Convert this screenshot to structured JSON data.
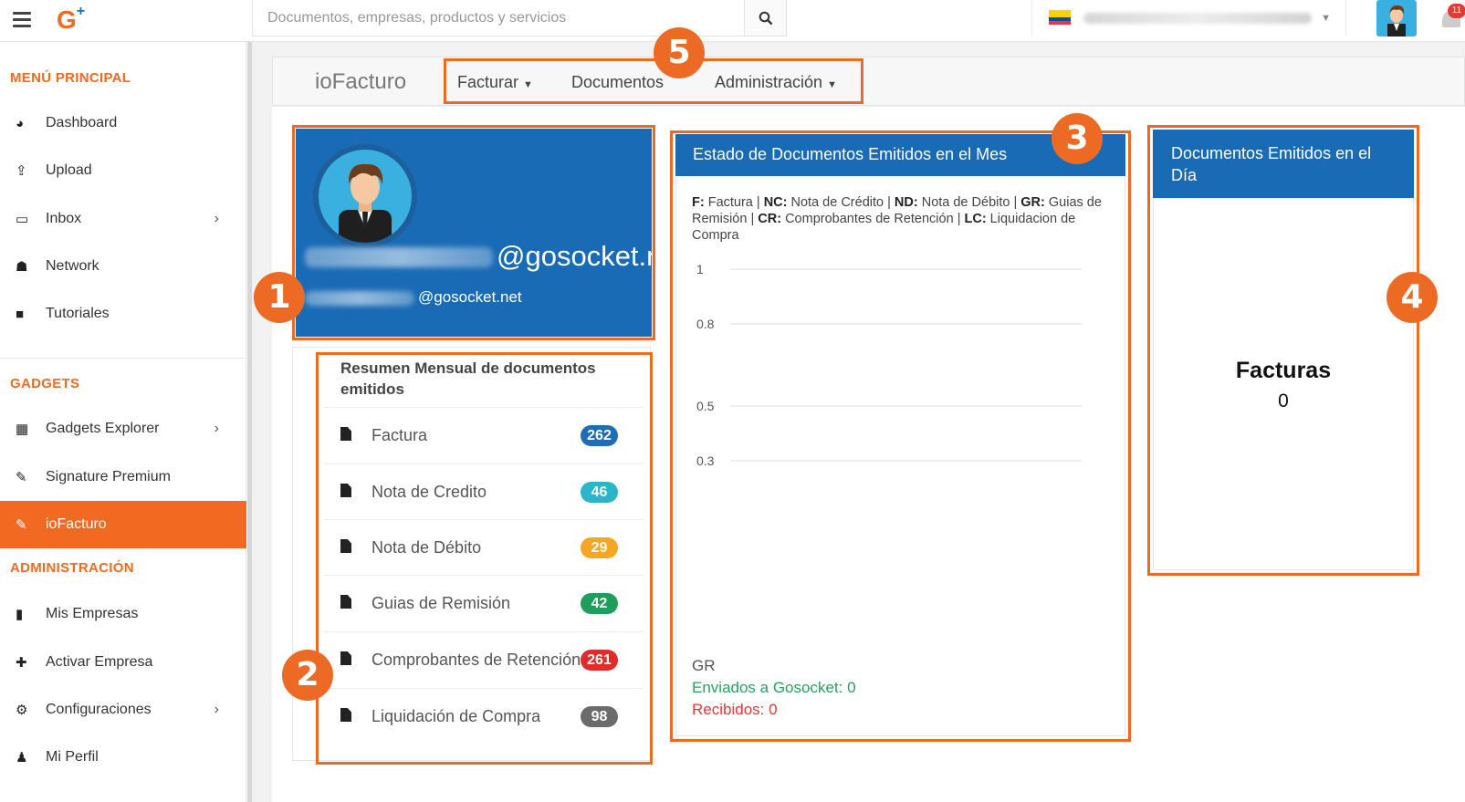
{
  "topbar": {
    "search_placeholder": "Documentos, empresas, productos y servicios",
    "notification_count": "11"
  },
  "sidebar": {
    "sections": [
      {
        "title": "MENÚ PRINCIPAL"
      },
      {
        "title": "GADGETS"
      },
      {
        "title": "ADMINISTRACIÓN"
      }
    ],
    "main_items": [
      {
        "label": "Dashboard",
        "icon": "dashboard-icon"
      },
      {
        "label": "Upload",
        "icon": "upload-icon"
      },
      {
        "label": "Inbox",
        "icon": "inbox-icon"
      },
      {
        "label": "Network",
        "icon": "network-icon"
      },
      {
        "label": "Tutoriales",
        "icon": "video-icon"
      }
    ],
    "gadget_items": [
      {
        "label": "Gadgets Explorer",
        "icon": "grid-icon"
      },
      {
        "label": "Signature Premium",
        "icon": "plug-icon"
      },
      {
        "label": "ioFacturo",
        "icon": "plug-icon"
      }
    ],
    "admin_items": [
      {
        "label": "Mis Empresas",
        "icon": "building-icon"
      },
      {
        "label": "Activar Empresa",
        "icon": "plus-icon"
      },
      {
        "label": "Configuraciones",
        "icon": "cogs-icon"
      },
      {
        "label": "Mi Perfil",
        "icon": "user-icon"
      }
    ]
  },
  "navbar": {
    "brand": "ioFacturo",
    "links": [
      "Facturar",
      "Documentos",
      "Administración"
    ]
  },
  "profile": {
    "email_domain_big": "@gosocket.r",
    "email_domain_small": "@gosocket.net"
  },
  "summary": {
    "title": "Resumen Mensual de documentos emitidos",
    "rows": [
      {
        "label": "Factura",
        "count": "262",
        "color": "#1f6db5"
      },
      {
        "label": "Nota de Credito",
        "count": "46",
        "color": "#2bb5c8"
      },
      {
        "label": "Nota de Débito",
        "count": "29",
        "color": "#f5a623"
      },
      {
        "label": "Guias de Remisión",
        "count": "42",
        "color": "#1e9e5a"
      },
      {
        "label": "Comprobantes de Retención",
        "count": "261",
        "color": "#e02b2b"
      },
      {
        "label": "Liquidación de Compra",
        "count": "98",
        "color": "#6b6b6b"
      }
    ]
  },
  "state": {
    "title": "Estado de Documentos Emitidos en el Mes",
    "legend": [
      {
        "code": "F:",
        "text": " Factura | "
      },
      {
        "code": "NC:",
        "text": " Nota de Crédito | "
      },
      {
        "code": "ND:",
        "text": " Nota de Débito | "
      },
      {
        "code": "GR:",
        "text": " Guias de Remisión | "
      },
      {
        "code": "CR:",
        "text": " Comprobantes de Retención | "
      },
      {
        "code": "LC:",
        "text": " Liquidacion de Compra"
      }
    ],
    "footer_label": "GR",
    "sent": "Enviados a Gosocket: 0",
    "received": "Recibidos: 0"
  },
  "chart_data": {
    "type": "bar",
    "categories": [],
    "series": [],
    "ytick_labels": [
      "1",
      "0.8",
      "0.5",
      "0.3"
    ],
    "ylim": [
      0,
      1
    ],
    "grid": true
  },
  "daily": {
    "title": "Documentos Emitidos en el Día",
    "label": "Facturas",
    "value": "0"
  },
  "markers": [
    "1",
    "2",
    "3",
    "4",
    "5"
  ]
}
